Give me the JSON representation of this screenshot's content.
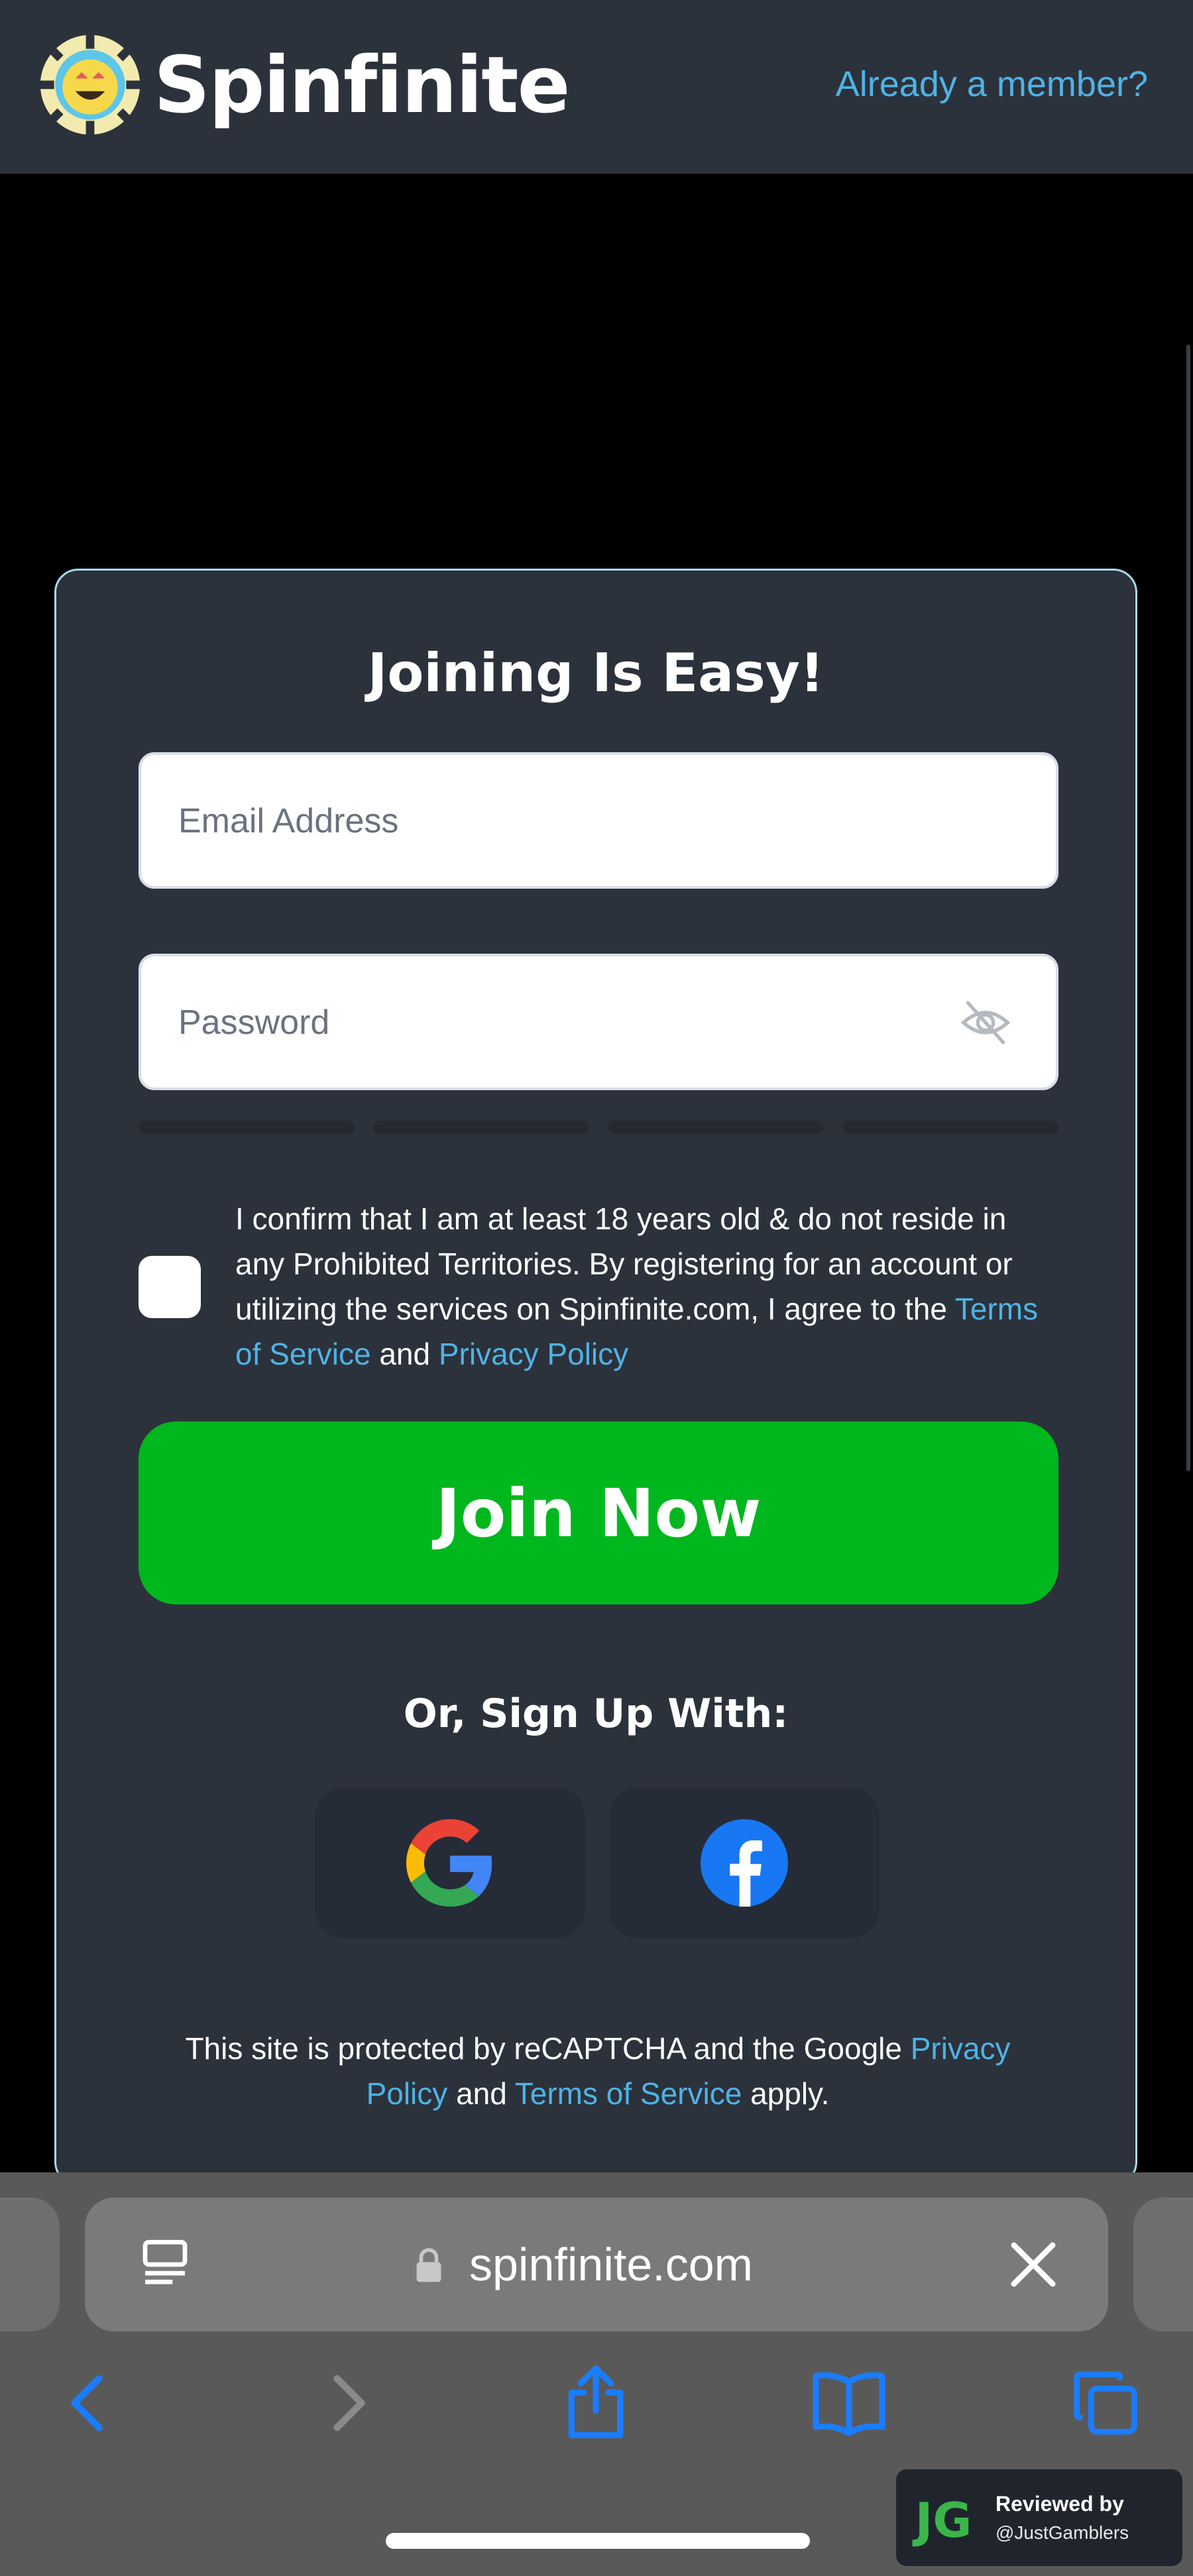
{
  "header": {
    "brand": "Spinfinite",
    "member_link": "Already a member?"
  },
  "form": {
    "title": "Joining Is Easy!",
    "email_placeholder": "Email Address",
    "password_placeholder": "Password",
    "consent_text": "I confirm that I am at least 18 years old & do not reside in any Prohibited Territories. By registering for an account or utilizing the services on Spinfinite.com, I agree to the",
    "consent_tos": "Terms of Service",
    "consent_and": "and",
    "consent_privacy": "Privacy Policy",
    "join_button": "Join Now",
    "or_signup": "Or, Sign Up With:",
    "social": [
      "google",
      "facebook"
    ],
    "recaptcha_prefix": "This site is protected by reCAPTCHA and the Google",
    "recaptcha_privacy": "Privacy Policy",
    "recaptcha_and": "and",
    "recaptcha_tos": "Terms of Service",
    "recaptcha_suffix": "apply."
  },
  "browser": {
    "url": "spinfinite.com"
  },
  "badge": {
    "line1": "Reviewed by",
    "line2": "@JustGamblers",
    "logo": "JG"
  },
  "colors": {
    "accent_link": "#4fb3e6",
    "join_green": "#00b71d",
    "panel": "#2c323b",
    "ios_blue": "#1a7cff"
  }
}
